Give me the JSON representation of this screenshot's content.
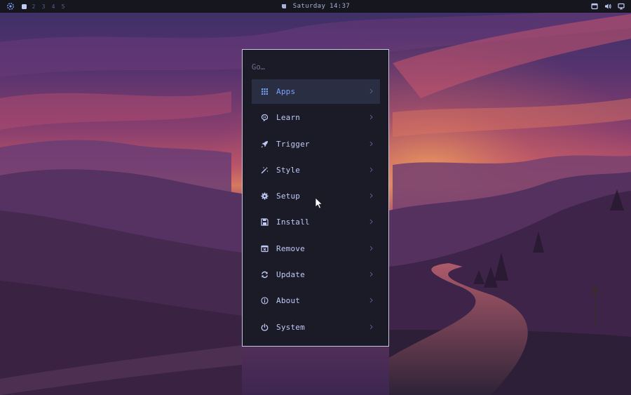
{
  "topbar": {
    "workspaces": [
      "2",
      "3",
      "4",
      "5"
    ],
    "clock": "Saturday 14:37"
  },
  "launcher": {
    "search_placeholder": "Go…",
    "items": [
      {
        "label": "Apps",
        "icon": "grid-icon",
        "selected": true
      },
      {
        "label": "Learn",
        "icon": "brain-icon",
        "selected": false
      },
      {
        "label": "Trigger",
        "icon": "rocket-icon",
        "selected": false
      },
      {
        "label": "Style",
        "icon": "magic-wand-icon",
        "selected": false
      },
      {
        "label": "Setup",
        "icon": "gear-icon",
        "selected": false
      },
      {
        "label": "Install",
        "icon": "save-icon",
        "selected": false
      },
      {
        "label": "Remove",
        "icon": "window-remove-icon",
        "selected": false
      },
      {
        "label": "Update",
        "icon": "refresh-icon",
        "selected": false
      },
      {
        "label": "About",
        "icon": "info-icon",
        "selected": false
      },
      {
        "label": "System",
        "icon": "power-icon",
        "selected": false
      }
    ]
  },
  "colors": {
    "panel_bg": "#1a1b26",
    "panel_border": "#c5c8dc",
    "selected_bg": "#292e42",
    "selected_text": "#7aa2f7",
    "text": "#c0caf5",
    "topbar_bg": "#16161e"
  }
}
